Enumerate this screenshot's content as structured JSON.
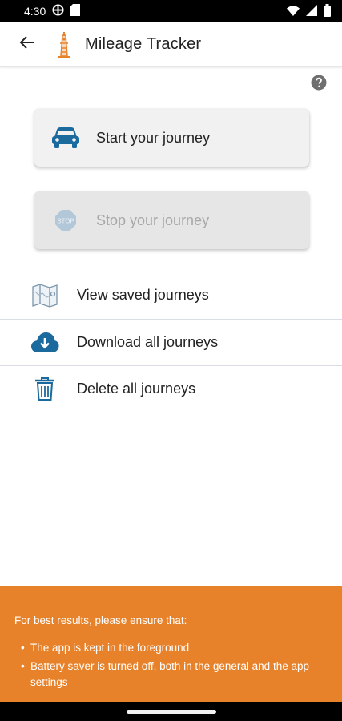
{
  "status_bar": {
    "time": "4:30",
    "icons": [
      "vpn-icon",
      "sd-card-icon",
      "wifi-icon",
      "signal-icon",
      "battery-icon"
    ]
  },
  "app_bar": {
    "title": "Mileage Tracker",
    "back_icon": "arrow-left-icon",
    "logo_icon": "mileage-tracker-logo"
  },
  "help": {
    "icon": "help-circle-icon"
  },
  "journey_buttons": {
    "start": {
      "label": "Start your journey",
      "icon": "car-icon",
      "enabled": true
    },
    "stop": {
      "label": "Stop your journey",
      "icon": "stop-sign-icon",
      "enabled": false
    }
  },
  "menu": {
    "items": [
      {
        "label": "View saved journeys",
        "icon": "map-icon"
      },
      {
        "label": "Download all journeys",
        "icon": "cloud-download-icon"
      },
      {
        "label": "Delete all journeys",
        "icon": "trash-icon"
      }
    ]
  },
  "info": {
    "intro": "For best results, please ensure that:",
    "tips": [
      "The app is kept in the foreground",
      "Battery saver is turned off, both in the general and the app settings"
    ]
  },
  "colors": {
    "accent_orange": "#e8822a",
    "icon_blue": "#1b6a9e",
    "disabled_gray": "#a8a8a8"
  }
}
